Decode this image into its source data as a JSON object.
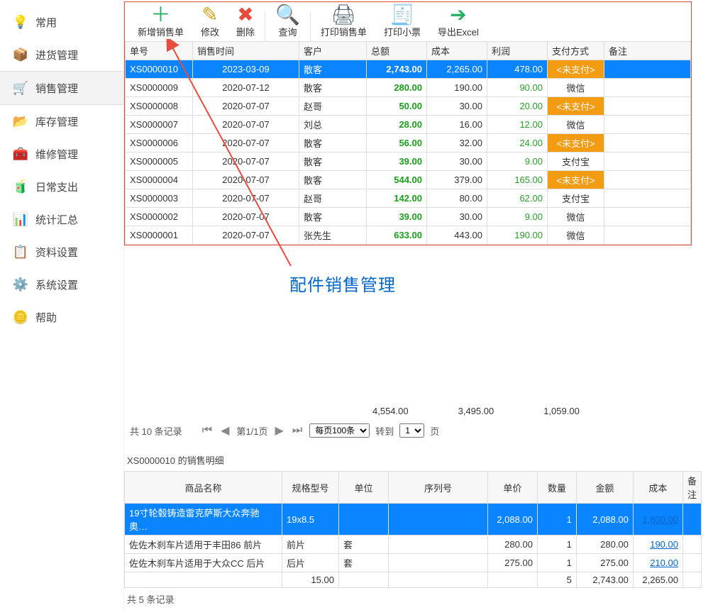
{
  "sidebar": {
    "items": [
      {
        "label": "常用",
        "icon": "💡"
      },
      {
        "label": "进货管理",
        "icon": "📦"
      },
      {
        "label": "销售管理",
        "icon": "🛒"
      },
      {
        "label": "库存管理",
        "icon": "📂"
      },
      {
        "label": "维修管理",
        "icon": "🧰"
      },
      {
        "label": "日常支出",
        "icon": "🧃"
      },
      {
        "label": "统计汇总",
        "icon": "📊"
      },
      {
        "label": "资料设置",
        "icon": "📋"
      },
      {
        "label": "系统设置",
        "icon": "⚙️"
      },
      {
        "label": "帮助",
        "icon": "🪙"
      }
    ],
    "active_index": 2
  },
  "toolbar": {
    "add": {
      "label": "新增销售单"
    },
    "edit": {
      "label": "修改"
    },
    "del": {
      "label": "删除"
    },
    "query": {
      "label": "查询"
    },
    "print": {
      "label": "打印销售单"
    },
    "receipt": {
      "label": "打印小票"
    },
    "export": {
      "label": "导出Excel"
    }
  },
  "sales_table": {
    "headers": {
      "sn": "单号",
      "time": "销售时间",
      "cust": "客户",
      "total": "总额",
      "cost": "成本",
      "profit": "利润",
      "pay": "支付方式",
      "remark": "备注"
    },
    "rows": [
      {
        "sn": "XS0000010",
        "time": "2023-03-09",
        "cust": "散客",
        "total": "2,743.00",
        "cost": "2,265.00",
        "profit": "478.00",
        "pay": "<未支付>",
        "unpaid": true
      },
      {
        "sn": "XS0000009",
        "time": "2020-07-12",
        "cust": "散客",
        "total": "280.00",
        "cost": "190.00",
        "profit": "90.00",
        "pay": "微信",
        "unpaid": false
      },
      {
        "sn": "XS0000008",
        "time": "2020-07-07",
        "cust": "赵哥",
        "total": "50.00",
        "cost": "30.00",
        "profit": "20.00",
        "pay": "<未支付>",
        "unpaid": true
      },
      {
        "sn": "XS0000007",
        "time": "2020-07-07",
        "cust": "刘总",
        "total": "28.00",
        "cost": "16.00",
        "profit": "12.00",
        "pay": "微信",
        "unpaid": false
      },
      {
        "sn": "XS0000006",
        "time": "2020-07-07",
        "cust": "散客",
        "total": "56.00",
        "cost": "32.00",
        "profit": "24.00",
        "pay": "<未支付>",
        "unpaid": true
      },
      {
        "sn": "XS0000005",
        "time": "2020-07-07",
        "cust": "散客",
        "total": "39.00",
        "cost": "30.00",
        "profit": "9.00",
        "pay": "支付宝",
        "unpaid": false
      },
      {
        "sn": "XS0000004",
        "time": "2020-07-07",
        "cust": "散客",
        "total": "544.00",
        "cost": "379.00",
        "profit": "165.00",
        "pay": "<未支付>",
        "unpaid": true
      },
      {
        "sn": "XS0000003",
        "time": "2020-07-07",
        "cust": "赵哥",
        "total": "142.00",
        "cost": "80.00",
        "profit": "62.00",
        "pay": "支付宝",
        "unpaid": false
      },
      {
        "sn": "XS0000002",
        "time": "2020-07-07",
        "cust": "散客",
        "total": "39.00",
        "cost": "30.00",
        "profit": "9.00",
        "pay": "微信",
        "unpaid": false
      },
      {
        "sn": "XS0000001",
        "time": "2020-07-07",
        "cust": "张先生",
        "total": "633.00",
        "cost": "443.00",
        "profit": "190.00",
        "pay": "微信",
        "unpaid": false
      }
    ],
    "selected_index": 0
  },
  "totals": {
    "total": "4,554.00",
    "cost": "3,495.00",
    "profit": "1,059.00"
  },
  "pager": {
    "count_text": "共 10 条记录",
    "page_text": "第1/1页",
    "per_page_options": [
      "每页100条"
    ],
    "per_page_selected": "每页100条",
    "goto_label_prefix": "转到",
    "goto_options": [
      "1"
    ],
    "goto_selected": "1",
    "goto_label_suffix": "页"
  },
  "detail": {
    "title": "XS0000010 的销售明细",
    "headers": {
      "name": "商品名称",
      "spec": "规格型号",
      "unit": "单位",
      "serial": "序列号",
      "price": "单价",
      "qty": "数量",
      "amount": "金额",
      "cost": "成本",
      "remark": "备注"
    },
    "rows": [
      {
        "name": "19寸轮毂铸造雷克萨斯大众奔驰奥…",
        "spec": "19x8.5",
        "unit": "",
        "serial": "",
        "price": "2,088.00",
        "qty": "1",
        "amount": "2,088.00",
        "cost": "1,800.00",
        "remark": ""
      },
      {
        "name": "佐佐木刹车片适用于丰田86 前片",
        "spec": "前片",
        "unit": "套",
        "serial": "",
        "price": "280.00",
        "qty": "1",
        "amount": "280.00",
        "cost": "190.00",
        "remark": ""
      },
      {
        "name": "佐佐木刹车片适用于大众CC 后片",
        "spec": "后片",
        "unit": "套",
        "serial": "",
        "price": "275.00",
        "qty": "1",
        "amount": "275.00",
        "cost": "210.00",
        "remark": ""
      }
    ],
    "summary": {
      "spec": "15.00",
      "qty": "5",
      "amount": "2,743.00",
      "cost": "2,265.00"
    },
    "footer_text": "共 5 条记录"
  },
  "annotation": {
    "text": "配件销售管理"
  }
}
